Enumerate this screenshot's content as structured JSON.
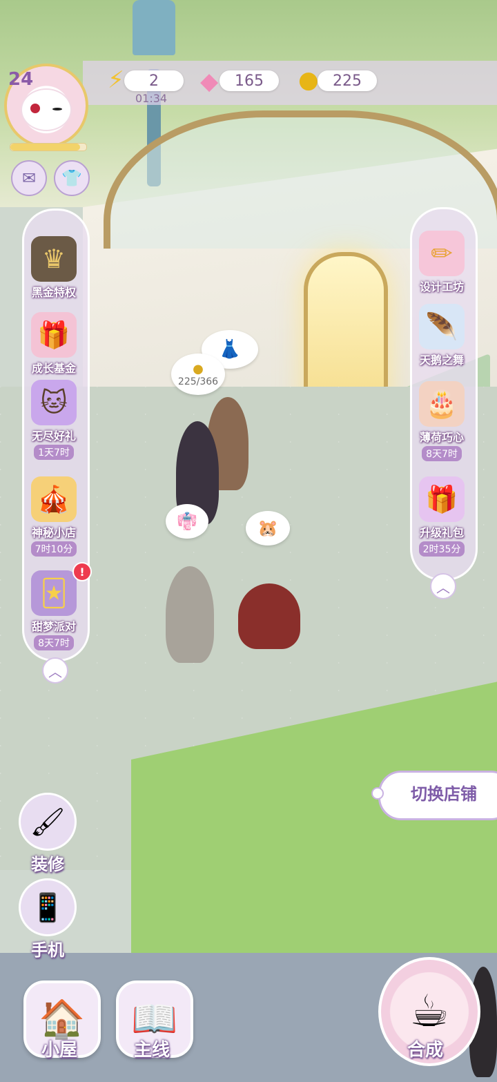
{
  "player": {
    "level": "24",
    "xp_fraction": 0.92
  },
  "resources": {
    "energy": {
      "value": "2",
      "timer": "01:34",
      "icon": "lightning-icon"
    },
    "gems": {
      "value": "165",
      "icon": "gem-icon"
    },
    "coins": {
      "value": "225",
      "icon": "coin-icon"
    }
  },
  "left_panel": {
    "items": [
      {
        "label": "黑金特权",
        "icon": "vip-card-icon",
        "timer": ""
      },
      {
        "label": "成长基金",
        "icon": "gift-boxes-icon",
        "timer": ""
      },
      {
        "label": "无尽好礼",
        "icon": "cat-gift-icon",
        "timer": "1天7时"
      },
      {
        "label": "神秘小店",
        "icon": "mystery-shop-icon",
        "timer": "7时10分"
      },
      {
        "label": "甜梦派对",
        "icon": "party-cards-icon",
        "timer": "8天7时",
        "badge": "!"
      }
    ]
  },
  "right_panel": {
    "items": [
      {
        "label": "设计工坊",
        "icon": "ruler-pencil-icon",
        "timer": ""
      },
      {
        "label": "天鹅之舞",
        "icon": "feather-icon",
        "timer": ""
      },
      {
        "label": "薄荷巧心",
        "icon": "cake-icon",
        "timer": "8天7时"
      },
      {
        "label": "升级礼包",
        "icon": "upgrade-gift-icon",
        "timer": "2时35分"
      }
    ]
  },
  "bubble": {
    "progress_text": "225/366"
  },
  "switch_shop": {
    "label": "切换店铺"
  },
  "side_buttons": {
    "decorate": "装修",
    "phone": "手机"
  },
  "bottom_nav": {
    "house": "小屋",
    "main_story": "主线",
    "merge": "合成"
  },
  "colors": {
    "accent": "#9d7cc0",
    "panel": "#e8dcf0",
    "label_outline": "#6d4a8c"
  }
}
